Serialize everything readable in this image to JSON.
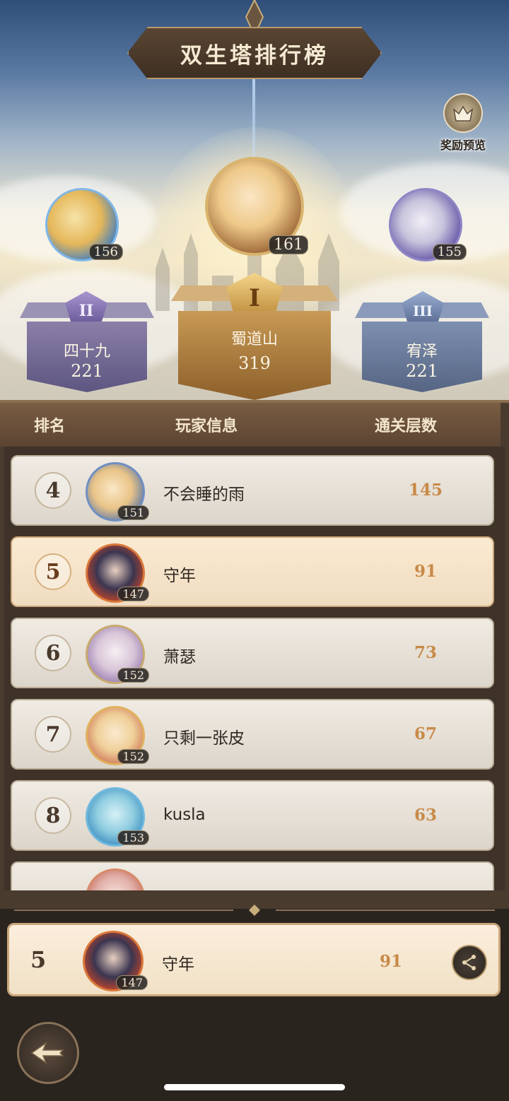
{
  "header": {
    "title": "双生塔排行榜",
    "reward_preview_label": "奖励预览"
  },
  "podium": {
    "first": {
      "rank_numeral": "I",
      "name": "蜀道山",
      "score": "319",
      "avatar_level": "161"
    },
    "second": {
      "rank_numeral": "II",
      "name": "四十九",
      "score": "221",
      "avatar_level": "156"
    },
    "third": {
      "rank_numeral": "III",
      "name": "宥泽",
      "score": "221",
      "avatar_level": "155"
    }
  },
  "columns": {
    "rank": "排名",
    "player": "玩家信息",
    "floors": "通关层数"
  },
  "rows": [
    {
      "rank": "4",
      "name": "不会睡的雨",
      "score": "145",
      "avatar_level": "151",
      "highlight": false
    },
    {
      "rank": "5",
      "name": "守年",
      "score": "91",
      "avatar_level": "147",
      "highlight": true
    },
    {
      "rank": "6",
      "name": "萧瑟",
      "score": "73",
      "avatar_level": "152",
      "highlight": false
    },
    {
      "rank": "7",
      "name": "只剩一张皮",
      "score": "67",
      "avatar_level": "152",
      "highlight": false
    },
    {
      "rank": "8",
      "name": "kusla",
      "score": "63",
      "avatar_level": "153",
      "highlight": false
    }
  ],
  "my_rank": {
    "rank": "5",
    "name": "守年",
    "score": "91",
    "avatar_level": "147"
  },
  "icons": {
    "reward": "crown-chest-icon",
    "share": "share-icon",
    "back": "back-arrow-icon"
  },
  "colors": {
    "gold": "#c88a48",
    "panel_brown": "#5c4433",
    "silver_purple": "#7a6f9a",
    "bronze_blue": "#6e7fa0"
  }
}
